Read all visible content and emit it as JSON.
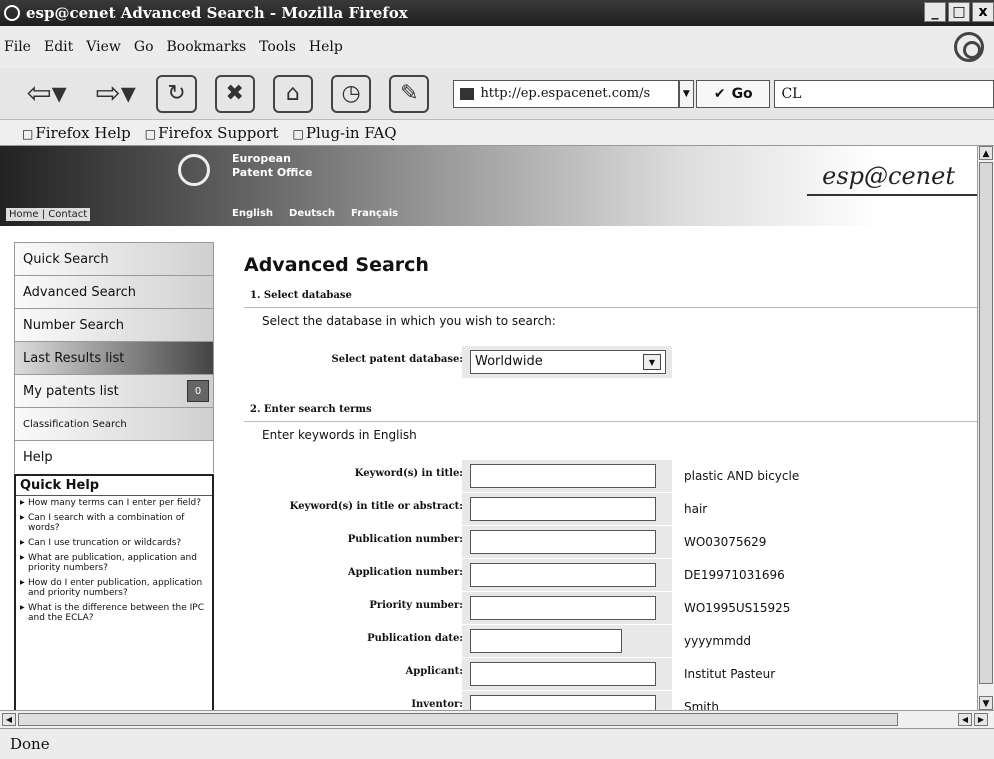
{
  "window": {
    "title": "esp@cenet Advanced Search - Mozilla Firefox",
    "buttons": [
      "_",
      "□",
      "x"
    ]
  },
  "menu": [
    "File",
    "Edit",
    "View",
    "Go",
    "Bookmarks",
    "Tools",
    "Help"
  ],
  "toolbar": {
    "url": "http://ep.espacenet.com/s",
    "go_label": "Go",
    "search_value": "CL"
  },
  "bookmarks": [
    "Firefox Help",
    "Firefox Support",
    "Plug-in FAQ"
  ],
  "status": "Done",
  "epo": {
    "org_line1": "European",
    "org_line2": "Patent Office",
    "home_links": "Home | Contact",
    "languages": [
      "English",
      "Deutsch",
      "Français"
    ],
    "brand": "esp@cenet"
  },
  "leftnav": {
    "items": [
      "Quick Search",
      "Advanced Search",
      "Number Search",
      "Last Results list",
      "My patents list",
      "Classification Search",
      "Help"
    ],
    "my_patents_count": "0"
  },
  "quickhelp": {
    "title": "Quick Help",
    "links": [
      "How many terms can I enter per field?",
      "Can I search with a combination of words?",
      "Can I use truncation or wildcards?",
      "What are publication, application and priority numbers?",
      "How do I enter publication, application and priority numbers?",
      "What is the difference between the IPC and the ECLA?"
    ]
  },
  "form": {
    "title": "Advanced Search",
    "section1": "1. Select database",
    "section1_instr": "Select the database in which you wish to search:",
    "db_label": "Select patent database:",
    "db_value": "Worldwide",
    "section2": "2. Enter search terms",
    "section2_instr": "Enter keywords in English",
    "fields": [
      {
        "label": "Keyword(s) in title:",
        "value": "",
        "example": "plastic AND bicycle"
      },
      {
        "label": "Keyword(s) in title or abstract:",
        "value": "",
        "example": "hair"
      },
      {
        "label": "Publication number:",
        "value": "",
        "example": "WO03075629"
      },
      {
        "label": "Application number:",
        "value": "",
        "example": "DE19971031696"
      },
      {
        "label": "Priority number:",
        "value": "",
        "example": "WO1995US15925"
      },
      {
        "label": "Publication date:",
        "value": "",
        "example": "yyyymmdd"
      },
      {
        "label": "Applicant:",
        "value": "",
        "example": "Institut Pasteur"
      },
      {
        "label": "Inventor:",
        "value": "",
        "example": "Smith"
      }
    ]
  }
}
